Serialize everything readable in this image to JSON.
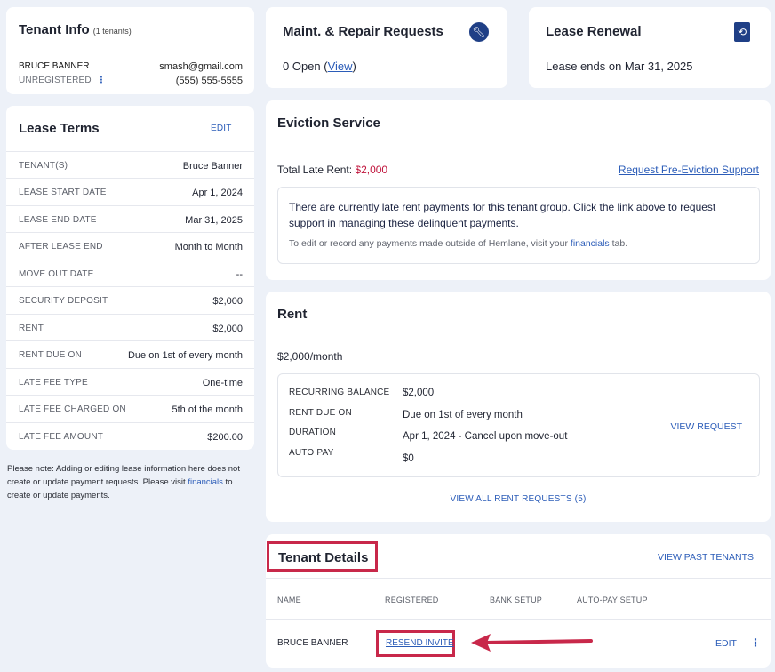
{
  "tenant_info": {
    "title": "Tenant Info",
    "count": "(1 tenants)",
    "name": "BRUCE BANNER",
    "email": "smash@gmail.com",
    "status": "UNREGISTERED",
    "phone": "(555) 555-5555"
  },
  "lease_terms": {
    "title": "Lease Terms",
    "edit_label": "EDIT",
    "rows": [
      {
        "key": "TENANT(S)",
        "value": "Bruce Banner"
      },
      {
        "key": "LEASE START DATE",
        "value": "Apr 1, 2024"
      },
      {
        "key": "LEASE END DATE",
        "value": "Mar 31, 2025"
      },
      {
        "key": "AFTER LEASE END",
        "value": "Month to Month"
      },
      {
        "key": "MOVE OUT DATE",
        "value": "--"
      },
      {
        "key": "SECURITY DEPOSIT",
        "value": "$2,000"
      },
      {
        "key": "RENT",
        "value": "$2,000"
      },
      {
        "key": "RENT DUE ON",
        "value": "Due on 1st of every month"
      },
      {
        "key": "LATE FEE TYPE",
        "value": "One-time"
      },
      {
        "key": "LATE FEE CHARGED ON",
        "value": "5th of the month"
      },
      {
        "key": "LATE FEE AMOUNT",
        "value": "$200.00"
      }
    ],
    "note_before": "Please note: Adding or editing lease information here does not create or update payment requests. Please visit ",
    "note_link": "financials",
    "note_after": " to create or update payments."
  },
  "maintenance": {
    "title": "Maint. & Repair Requests",
    "open_text": "0 Open (",
    "view_label": "View",
    "close_paren": ")",
    "icon": "wrench-icon"
  },
  "lease_renewal": {
    "title": "Lease Renewal",
    "ends_text": "Lease ends on Mar 31, 2025",
    "icon": "renew-document-icon"
  },
  "eviction": {
    "title": "Eviction Service",
    "late_label": "Total Late Rent: ",
    "late_amount": "$2,000",
    "request_link": "Request Pre-Eviction Support",
    "message": "There are currently late rent payments for this tenant group. Click the link above to request support in managing these delinquent payments.",
    "sub_before": "To edit or record any payments made outside of Hemlane, visit your ",
    "sub_link": "financials",
    "sub_after": " tab."
  },
  "rent": {
    "title": "Rent",
    "per_month": "$2,000/month",
    "details": [
      {
        "key": "RECURRING BALANCE",
        "value": "$2,000"
      },
      {
        "key": "RENT DUE ON",
        "value": "Due on 1st of every month"
      },
      {
        "key": "DURATION",
        "value": "Apr 1, 2024 - Cancel upon move-out"
      },
      {
        "key": "AUTO PAY",
        "value": "$0"
      }
    ],
    "view_request": "VIEW REQUEST",
    "view_all": "VIEW ALL RENT REQUESTS (5)"
  },
  "tenant_details": {
    "title": "Tenant Details",
    "view_past": "VIEW PAST TENANTS",
    "columns": [
      "NAME",
      "REGISTERED",
      "BANK SETUP",
      "AUTO-PAY SETUP"
    ],
    "row": {
      "name": "BRUCE BANNER",
      "registered_action": "RESEND INVITE",
      "edit_label": "EDIT"
    }
  },
  "colors": {
    "background": "#edf1f8",
    "link": "#2b5cb8",
    "late_amount": "#c0143c",
    "highlight": "#c8284a",
    "icon_bg": "#1f3f86"
  }
}
